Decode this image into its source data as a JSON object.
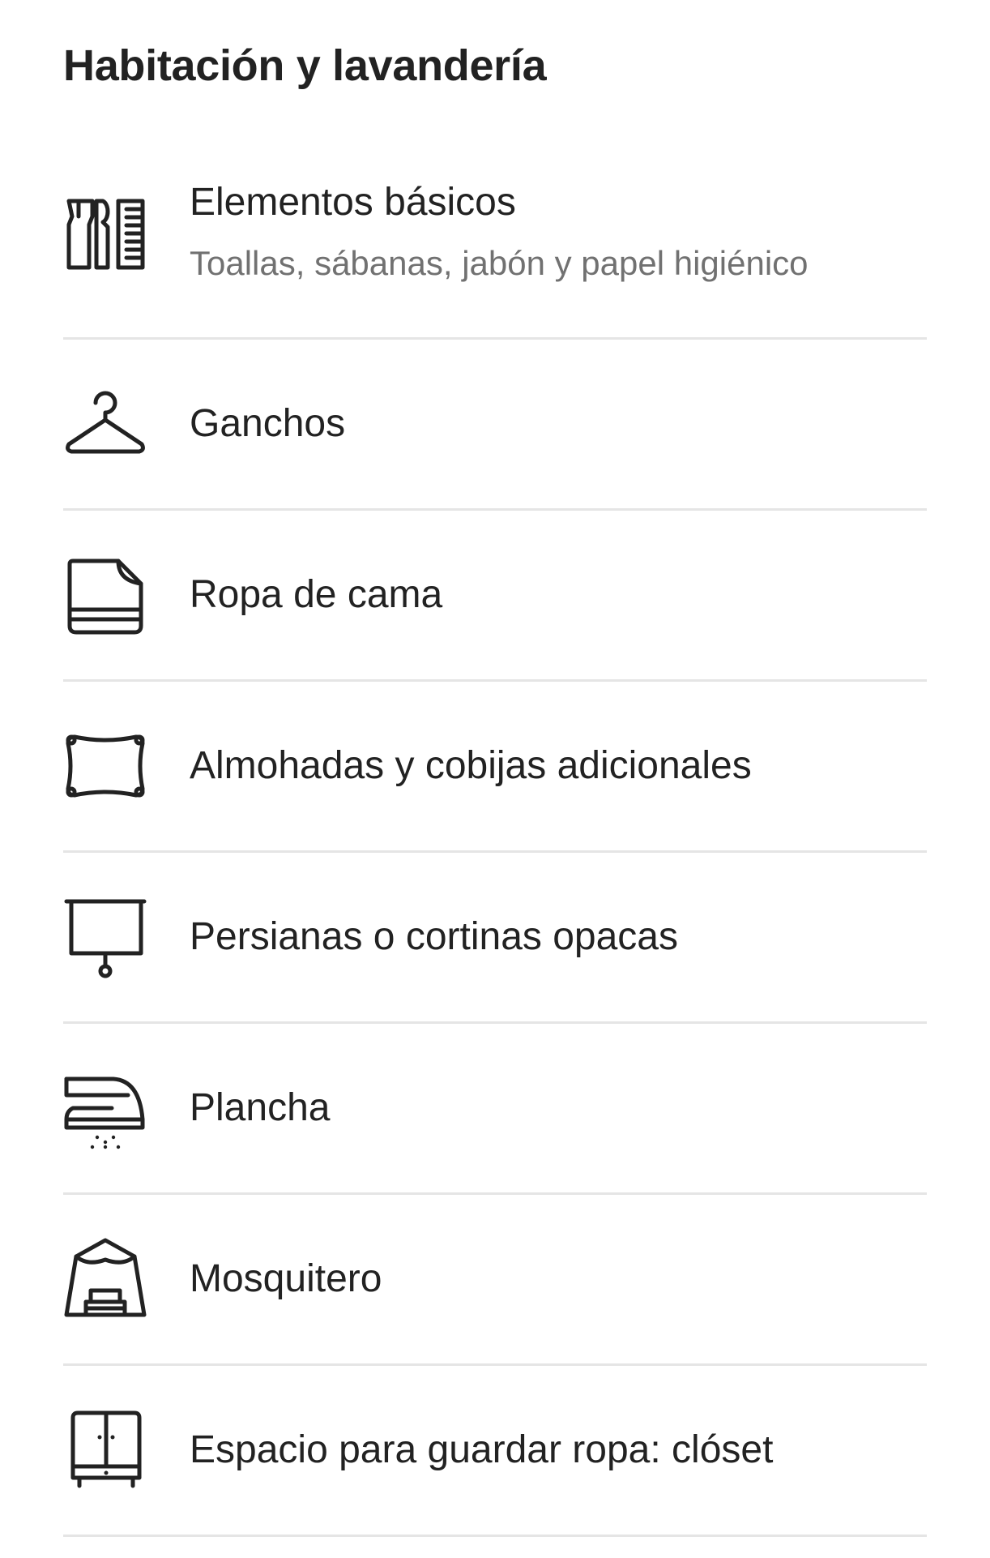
{
  "section": {
    "title": "Habitación y lavandería"
  },
  "amenities": [
    {
      "label": "Elementos básicos",
      "sublabel": "Toallas, sábanas, jabón y papel higiénico",
      "icon": "essentials-icon"
    },
    {
      "label": "Ganchos",
      "icon": "hanger-icon"
    },
    {
      "label": "Ropa de cama",
      "icon": "bed-linens-icon"
    },
    {
      "label": "Almohadas y cobijas adicionales",
      "icon": "pillow-icon"
    },
    {
      "label": "Persianas o cortinas opacas",
      "icon": "blinds-icon"
    },
    {
      "label": "Plancha",
      "icon": "iron-icon"
    },
    {
      "label": "Mosquitero",
      "icon": "mosquito-net-icon"
    },
    {
      "label": "Espacio para guardar ropa: clóset",
      "icon": "closet-icon"
    }
  ],
  "colors": {
    "text": "#222222",
    "secondary_text": "#717171",
    "divider": "#e5e5e5"
  }
}
